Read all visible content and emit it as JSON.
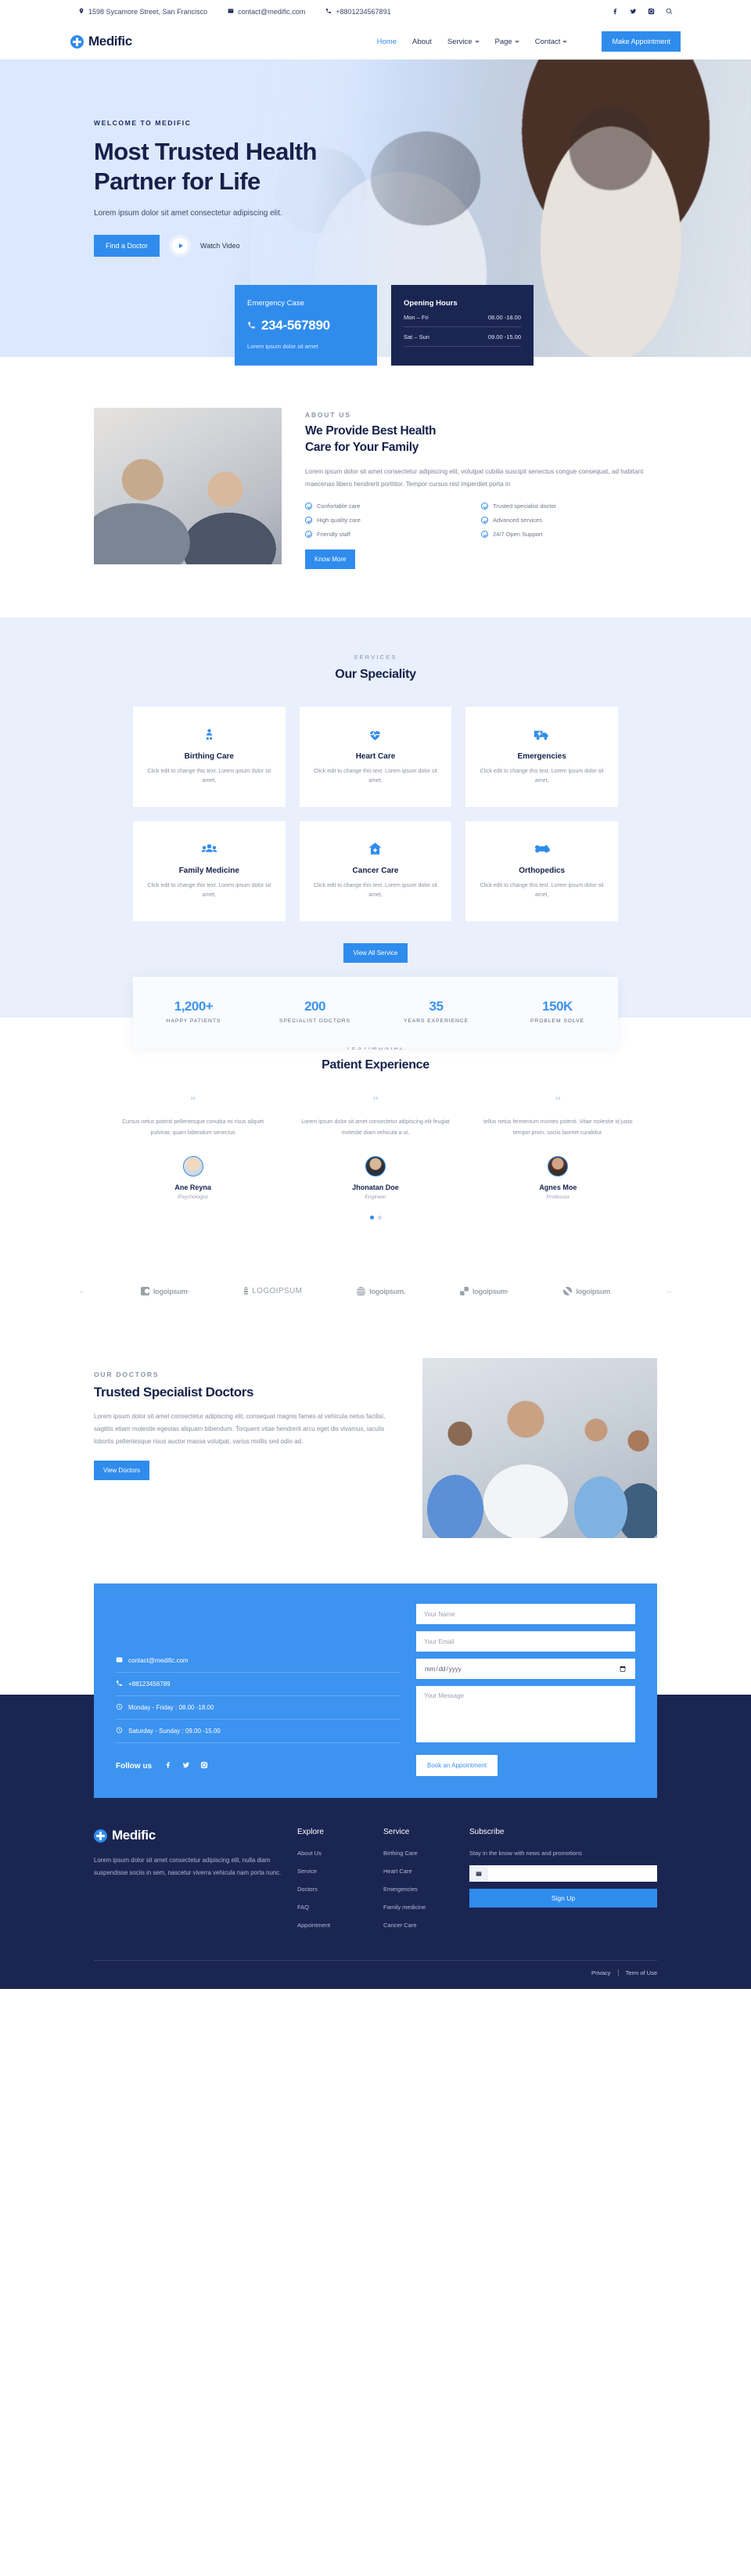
{
  "topbar": {
    "address": "1598 Sycamore Street, San Francisco",
    "email": "contact@medific.com",
    "phone": "+8801234567891",
    "socials": [
      "facebook-icon",
      "twitter-icon",
      "instagram-icon",
      "search-icon"
    ]
  },
  "nav": {
    "brand": "Medific",
    "links": [
      {
        "label": "Home",
        "active": true,
        "caret": false
      },
      {
        "label": "About",
        "active": false,
        "caret": false
      },
      {
        "label": "Service",
        "active": false,
        "caret": true
      },
      {
        "label": "Page",
        "active": false,
        "caret": true
      },
      {
        "label": "Contact",
        "active": false,
        "caret": true
      }
    ],
    "cta": "Make Appointment"
  },
  "hero": {
    "eyebrow": "WELCOME TO MEDIFIC",
    "title_line1": "Most Trusted Health",
    "title_line2": "Partner for Life",
    "subtitle": "Lorem ipsum dolor sit amet consectetur adipiscing elit.",
    "primary_btn": "Find a Doctor",
    "watch_label": "Watch Video"
  },
  "emergency": {
    "title": "Emergency Case",
    "number": "234-567890",
    "note": "Lorem ipsum dolor sit amet"
  },
  "hours": {
    "title": "Opening Hours",
    "rows": [
      {
        "days": "Mon – Fri",
        "time": "08.00 -18.00"
      },
      {
        "days": "Sat – Sun",
        "time": "09.00 -15.00"
      }
    ]
  },
  "about": {
    "eyebrow": "ABOUT US",
    "title_line1": "We Provide Best Health",
    "title_line2": "Care for Your Family",
    "paragraph": "Lorem ipsum dolor sit amet consectetur adipiscing elit, volutpat cubilia suscipit senectus congue consequat, ad habitant maecenas libero hendrerit porttitor. Tempor cursus nisl imperdiet porta in",
    "features": [
      "Confortable care",
      "Trusted specialist doctor",
      "High quality care",
      "Advanced services",
      "Friendly staff",
      "24/7 Open Support"
    ],
    "button": "Know More"
  },
  "services": {
    "eyebrow": "SERVICES",
    "title": "Our Speciality",
    "cards": [
      {
        "icon": "baby-icon",
        "name": "Birthing Care",
        "desc": "Click edit to change this text. Lorem ipsum dolor sit amet,"
      },
      {
        "icon": "heart-pulse-icon",
        "name": "Heart Care",
        "desc": "Click edit to change this text. Lorem ipsum dolor sit amet,"
      },
      {
        "icon": "ambulance-icon",
        "name": "Emergencies",
        "desc": "Click edit to change this text. Lorem ipsum dolor sit amet,"
      },
      {
        "icon": "people-group-icon",
        "name": "Family Medicine",
        "desc": "Click edit to change this text. Lorem ipsum dolor sit amet,"
      },
      {
        "icon": "hospital-house-icon",
        "name": "Cancer Care",
        "desc": "Click edit to change this text. Lorem ipsum dolor sit amet,"
      },
      {
        "icon": "bone-icon",
        "name": "Orthopedics",
        "desc": "Click edit to change this text. Lorem ipsum dolor sit amet,"
      }
    ],
    "button": "View All Service"
  },
  "stats": [
    {
      "value": "1,200+",
      "label": "HAPPY PATIENTS"
    },
    {
      "value": "200",
      "label": "SPECIALIST DOCTORS"
    },
    {
      "value": "35",
      "label": "YEARS EXPERIENCE"
    },
    {
      "value": "150K",
      "label": "PROBLEM SOLVE"
    }
  ],
  "testimonial": {
    "eyebrow": "TESTIMONIAL",
    "title": "Patient Experience",
    "items": [
      {
        "quote": "Cursus netus potenti pellentesque conubia mi risus aliquet pulvinar, quam bibendum senectus",
        "name": "Ane Reyna",
        "role": "Psychologist"
      },
      {
        "quote": "Lorem ipsum dolor sit amet consectetur adipiscing elit feugiat molestie diam vehicula a ut,",
        "name": "Jhonatan Doe",
        "role": "Engineer"
      },
      {
        "quote": "tellus netus fermentum montes potenti. Vitae molestie id justo tempor proin, sociis laoreet curabitur.",
        "name": "Agnes Moe",
        "role": "Professor"
      }
    ],
    "dots": 2,
    "active_dot": 0
  },
  "logos": [
    {
      "text": "logoipsum·",
      "style": "s1",
      "caps": false
    },
    {
      "text": "LOGOIPSUM",
      "style": "s2",
      "caps": true
    },
    {
      "text": "logoipsum.",
      "style": "s3",
      "caps": false
    },
    {
      "text": "logoipsum·",
      "style": "s4",
      "caps": false
    },
    {
      "text": "logoipsum",
      "style": "s5",
      "caps": false
    }
  ],
  "doctors": {
    "eyebrow": "OUR DOCTORS",
    "title": "Trusted Specialist Doctors",
    "paragraph": "Lorem ipsum dolor sit amet consectetur adipiscing elit, consequat magnis fames at vehicula netus facilisi, sagittis etiam molestie egestas aliquam bibendum. Torquent vitae hendrerit arcu eget dis vivamus, iaculis lobortis pellentesque risus auctor massa volutpat, varius mollis sed odio ad.",
    "button": "View Doctors"
  },
  "contact": {
    "email": "contact@medific.com",
    "phone": "+88123456789",
    "weekday_hours": "Monday - Friday : 08.00 -18.00",
    "weekend_hours": "Saturday - Sunday : 09.00 -15.00",
    "follow_label": "Follow us",
    "socials": [
      "facebook-icon",
      "twitter-icon",
      "instagram-icon"
    ],
    "name_placeholder": "Your Name",
    "email_placeholder": "Your Email",
    "date_placeholder": "mm/dd/yyyy",
    "message_placeholder": "Your Message",
    "submit": "Book an Appointment"
  },
  "footer": {
    "brand": "Medific",
    "about": "Lorem ipsum dolor sit amet consectetur adipiscing elit, nulla diam suspendisse sociis in sem, nascetur viverra vehicula nam porta nunc.",
    "explore_title": "Explore",
    "explore": [
      "About Us",
      "Service",
      "Doctors",
      "FAQ",
      "Appointment"
    ],
    "service_title": "Service",
    "service": [
      "Birthing Care",
      "Heart Care",
      "Emergencies",
      "Family medicine",
      "Cancer Care"
    ],
    "subscribe_title": "Subscribe",
    "subscribe_note": "Stay in the know with news and promotions",
    "subscribe_value": "",
    "signup": "Sign Up",
    "privacy": "Privacy",
    "terms": "Term of Use"
  },
  "colors": {
    "accent": "#2f8ced",
    "dark": "#1b2552",
    "light_bg": "#e9effb"
  }
}
